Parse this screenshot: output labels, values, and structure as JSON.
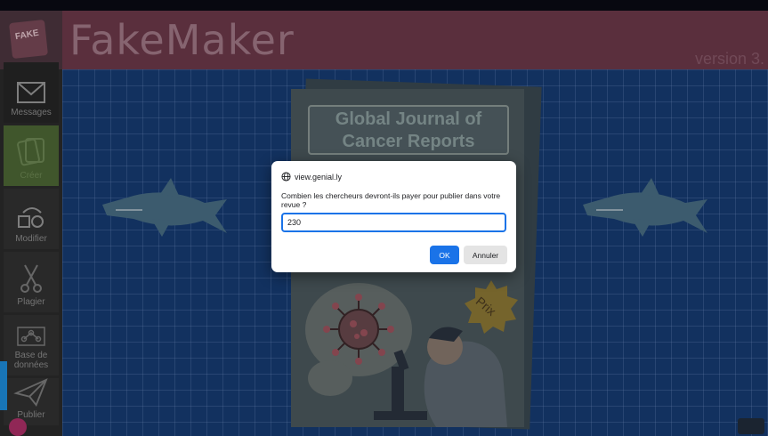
{
  "app": {
    "title": "FakeMaker",
    "version": "version 3.",
    "logo_tag": "FAKE"
  },
  "sidebar": {
    "items": [
      {
        "label": "Messages",
        "icon": "envelope-icon"
      },
      {
        "label": "Créer",
        "icon": "cards-icon"
      },
      {
        "label": "Modifier",
        "icon": "shapes-icon"
      },
      {
        "label": "Plagier",
        "icon": "scissors-icon"
      },
      {
        "label": "Base de données",
        "icon": "network-icon"
      },
      {
        "label": "Publier",
        "icon": "paper-plane-icon"
      }
    ]
  },
  "journal": {
    "title": "Global Journal of Cancer Reports",
    "badge": "Prix"
  },
  "dialog": {
    "site": "view.genial.ly",
    "message": "Combien les chercheurs devront-ils payer pour publier dans votre revue ?",
    "input_value": "230",
    "ok_label": "OK",
    "cancel_label": "Annuler"
  },
  "colors": {
    "header": "#6e3a4b",
    "grid": "#163c74",
    "accent": "#1a73e8",
    "creer_active": "#4f6a36"
  }
}
